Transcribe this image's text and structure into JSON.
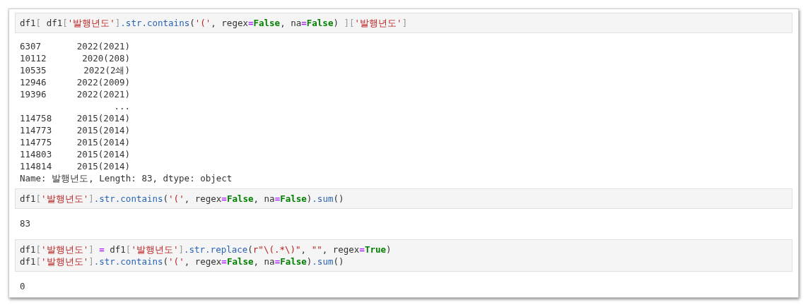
{
  "cells": [
    {
      "kind": "input",
      "lines": [
        [
          {
            "kind": "var",
            "text": "df1"
          },
          {
            "kind": "bracket",
            "text": "[ "
          },
          {
            "kind": "var",
            "text": "df1"
          },
          {
            "kind": "bracket",
            "text": "["
          },
          {
            "kind": "string",
            "text": "'발행년도'"
          },
          {
            "kind": "bracket",
            "text": "]"
          },
          {
            "kind": "prop",
            "text": ".str.contains"
          },
          {
            "kind": "plain",
            "text": "("
          },
          {
            "kind": "string",
            "text": "'('"
          },
          {
            "kind": "plain",
            "text": ", regex"
          },
          {
            "kind": "op",
            "text": "="
          },
          {
            "kind": "keyword",
            "text": "False"
          },
          {
            "kind": "plain",
            "text": ", na"
          },
          {
            "kind": "op",
            "text": "="
          },
          {
            "kind": "keyword",
            "text": "False"
          },
          {
            "kind": "plain",
            "text": ") "
          },
          {
            "kind": "bracket",
            "text": "]["
          },
          {
            "kind": "string",
            "text": "'발행년도'"
          },
          {
            "kind": "bracket",
            "text": "]"
          }
        ]
      ]
    },
    {
      "kind": "series",
      "rows": [
        {
          "index": "6307",
          "value": "2022(2021)"
        },
        {
          "index": "10112",
          "value": "2020(208)"
        },
        {
          "index": "10535",
          "value": "2022(2쇄)"
        },
        {
          "index": "12946",
          "value": "2022(2009)"
        },
        {
          "index": "19396",
          "value": "2022(2021)"
        },
        {
          "index": "",
          "value": "..."
        },
        {
          "index": "114758",
          "value": "2015(2014)"
        },
        {
          "index": "114773",
          "value": "2015(2014)"
        },
        {
          "index": "114775",
          "value": "2015(2014)"
        },
        {
          "index": "114803",
          "value": "2015(2014)"
        },
        {
          "index": "114814",
          "value": "2015(2014)"
        }
      ],
      "footer": "Name: 발행년도, Length: 83, dtype: object"
    },
    {
      "kind": "input",
      "lines": [
        [
          {
            "kind": "var",
            "text": "df1"
          },
          {
            "kind": "bracket",
            "text": "["
          },
          {
            "kind": "string",
            "text": "'발행년도'"
          },
          {
            "kind": "bracket",
            "text": "]"
          },
          {
            "kind": "prop",
            "text": ".str.contains"
          },
          {
            "kind": "plain",
            "text": "("
          },
          {
            "kind": "string",
            "text": "'('"
          },
          {
            "kind": "plain",
            "text": ", regex"
          },
          {
            "kind": "op",
            "text": "="
          },
          {
            "kind": "keyword",
            "text": "False"
          },
          {
            "kind": "plain",
            "text": ", na"
          },
          {
            "kind": "op",
            "text": "="
          },
          {
            "kind": "keyword",
            "text": "False"
          },
          {
            "kind": "plain",
            "text": ")"
          },
          {
            "kind": "prop",
            "text": ".sum"
          },
          {
            "kind": "plain",
            "text": "()"
          }
        ]
      ]
    },
    {
      "kind": "text",
      "text": "83"
    },
    {
      "kind": "input",
      "lines": [
        [
          {
            "kind": "var",
            "text": "df1"
          },
          {
            "kind": "bracket",
            "text": "["
          },
          {
            "kind": "string",
            "text": "'발행년도'"
          },
          {
            "kind": "bracket",
            "text": "]"
          },
          {
            "kind": "op",
            "text": " = "
          },
          {
            "kind": "var",
            "text": "df1"
          },
          {
            "kind": "bracket",
            "text": "["
          },
          {
            "kind": "string",
            "text": "'발행년도'"
          },
          {
            "kind": "bracket",
            "text": "]"
          },
          {
            "kind": "prop",
            "text": ".str.replace"
          },
          {
            "kind": "plain",
            "text": "("
          },
          {
            "kind": "string",
            "text": "r\"\\(.*\\)\""
          },
          {
            "kind": "plain",
            "text": ", "
          },
          {
            "kind": "string",
            "text": "\"\""
          },
          {
            "kind": "plain",
            "text": ", regex"
          },
          {
            "kind": "op",
            "text": "="
          },
          {
            "kind": "keyword",
            "text": "True"
          },
          {
            "kind": "plain",
            "text": ")"
          }
        ],
        [
          {
            "kind": "var",
            "text": "df1"
          },
          {
            "kind": "bracket",
            "text": "["
          },
          {
            "kind": "string",
            "text": "'발행년도'"
          },
          {
            "kind": "bracket",
            "text": "]"
          },
          {
            "kind": "prop",
            "text": ".str.contains"
          },
          {
            "kind": "plain",
            "text": "("
          },
          {
            "kind": "string",
            "text": "'('"
          },
          {
            "kind": "plain",
            "text": ", regex"
          },
          {
            "kind": "op",
            "text": "="
          },
          {
            "kind": "keyword",
            "text": "False"
          },
          {
            "kind": "plain",
            "text": ", na"
          },
          {
            "kind": "op",
            "text": "="
          },
          {
            "kind": "keyword",
            "text": "False"
          },
          {
            "kind": "plain",
            "text": ")"
          },
          {
            "kind": "prop",
            "text": ".sum"
          },
          {
            "kind": "plain",
            "text": "()"
          }
        ]
      ]
    },
    {
      "kind": "text",
      "text": "0"
    }
  ]
}
